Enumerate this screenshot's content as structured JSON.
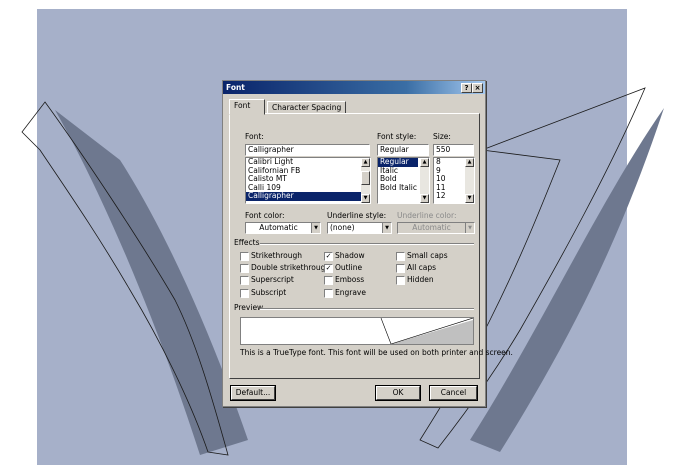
{
  "dialog": {
    "title": "Font",
    "help_button": "?",
    "close_button": "×",
    "tabs": [
      {
        "label": "Font",
        "active": true
      },
      {
        "label": "Character Spacing",
        "active": false
      }
    ],
    "font_label": "Font:",
    "font_value": "Calligrapher",
    "font_list": [
      "Calibri Light",
      "Californian FB",
      "Calisto MT",
      "Calli 109",
      "Calligrapher"
    ],
    "font_selected": "Calligrapher",
    "style_label": "Font style:",
    "style_value": "Regular",
    "style_list": [
      "Regular",
      "Italic",
      "Bold",
      "Bold Italic"
    ],
    "style_selected": "Regular",
    "size_label": "Size:",
    "size_value": "550",
    "size_list": [
      "8",
      "9",
      "10",
      "11",
      "12"
    ],
    "font_color_label": "Font color:",
    "font_color_value": "Automatic",
    "underline_style_label": "Underline style:",
    "underline_style_value": "(none)",
    "underline_color_label": "Underline color:",
    "underline_color_value": "Automatic",
    "effects_label": "Effects",
    "effects": [
      {
        "label": "Strikethrough",
        "checked": false
      },
      {
        "label": "Double strikethrough",
        "checked": false
      },
      {
        "label": "Superscript",
        "checked": false
      },
      {
        "label": "Subscript",
        "checked": false
      },
      {
        "label": "Shadow",
        "checked": true
      },
      {
        "label": "Outline",
        "checked": true
      },
      {
        "label": "Emboss",
        "checked": false
      },
      {
        "label": "Engrave",
        "checked": false
      },
      {
        "label": "Small caps",
        "checked": false
      },
      {
        "label": "All caps",
        "checked": false
      },
      {
        "label": "Hidden",
        "checked": false
      }
    ],
    "preview_label": "Preview",
    "preview_note": "This is a TrueType font. This font will be used on both printer and screen.",
    "default_button": "Default...",
    "ok_button": "OK",
    "cancel_button": "Cancel"
  },
  "colors": {
    "slide_background": "#a6b0c9",
    "shadow": "#6e788f",
    "titlebar": "#0a246a",
    "dialog_face": "#d4d0c8"
  }
}
